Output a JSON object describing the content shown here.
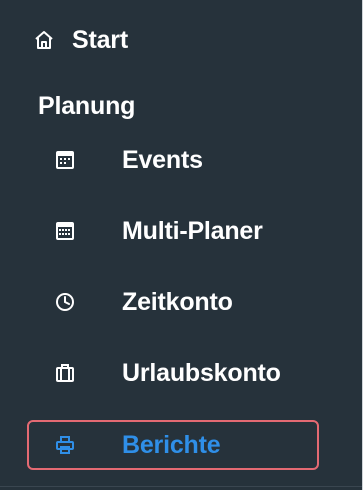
{
  "nav": {
    "start": {
      "label": "Start",
      "icon": "home-icon"
    },
    "section": {
      "label": "Planung"
    },
    "items": [
      {
        "label": "Events",
        "icon": "calendar-icon"
      },
      {
        "label": "Multi-Planer",
        "icon": "calendar-grid-icon"
      },
      {
        "label": "Zeitkonto",
        "icon": "clock-icon"
      },
      {
        "label": "Urlaubskonto",
        "icon": "briefcase-icon"
      },
      {
        "label": "Berichte",
        "icon": "printer-icon",
        "active": true
      }
    ]
  },
  "colors": {
    "sidebar_bg": "#26323b",
    "text": "#ffffff",
    "active_text": "#2f8fe8",
    "highlight_border": "#e46a73"
  }
}
